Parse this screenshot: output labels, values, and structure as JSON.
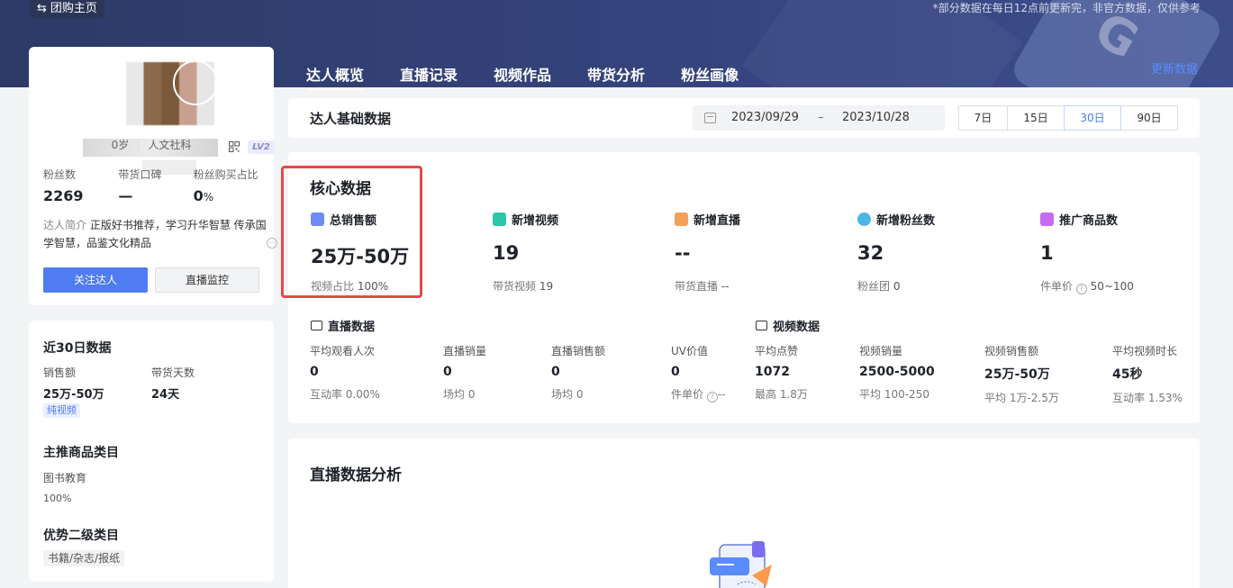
{
  "header": {
    "back_label": "团购主页",
    "notice": "*部分数据在每日12点前更新完，非官方数据，仅供参考",
    "update_link": "更新数据",
    "tabs": [
      {
        "label": "达人概览",
        "active": true
      },
      {
        "label": "直播记录",
        "active": false
      },
      {
        "label": "视频作品",
        "active": false
      },
      {
        "label": "带货分析",
        "active": false
      },
      {
        "label": "粉丝画像",
        "active": false
      }
    ]
  },
  "profile": {
    "level_badge": "LV2",
    "age": "0岁",
    "category": "人文社科",
    "stats": [
      {
        "label": "粉丝数",
        "value": "2269",
        "unit": ""
      },
      {
        "label": "带货口碑",
        "value": "—",
        "unit": ""
      },
      {
        "label": "粉丝购买占比",
        "value": "0",
        "unit": "%"
      }
    ],
    "intro_key": "达人简介",
    "intro_text": "正版好书推荐，学习升华智慧 传承国学智慧，品鉴文化精品",
    "follow_button": "关注达人",
    "monitor_button": "直播监控"
  },
  "recent": {
    "title": "近30日数据",
    "sales_label": "销售额",
    "sales_value": "25万-50万",
    "days_label": "带货天数",
    "days_value": "24天",
    "tag": "纯视频",
    "main_category_title": "主推商品类目",
    "main_category": "图书教育",
    "main_category_pct": "100%",
    "sub_category_title": "优势二级类目",
    "sub_category": "书籍/杂志/报纸"
  },
  "datebar": {
    "title": "达人基础数据",
    "start_date": "2023/09/29",
    "separator": "–",
    "end_date": "2023/10/28",
    "ranges": [
      {
        "label": "7日",
        "active": false
      },
      {
        "label": "15日",
        "active": false
      },
      {
        "label": "30日",
        "active": true
      },
      {
        "label": "90日",
        "active": false
      }
    ]
  },
  "core": {
    "title": "核心数据",
    "metrics": [
      {
        "label": "总销售额",
        "value": "25万-50万",
        "sub_label": "视频占比",
        "sub_value": "100%",
        "icon": "money-icon",
        "color": "#6b8cf5"
      },
      {
        "label": "新增视频",
        "value": "19",
        "sub_label": "带货视频",
        "sub_value": "19",
        "icon": "video-play-icon",
        "color": "#2cc6a8"
      },
      {
        "label": "新增直播",
        "value": "--",
        "sub_label": "带货直播",
        "sub_value": "--",
        "icon": "live-camera-icon",
        "color": "#f5a05a"
      },
      {
        "label": "新增粉丝数",
        "value": "32",
        "sub_label": "粉丝团",
        "sub_value": "0",
        "icon": "user-icon",
        "color": "#4cb6e8"
      },
      {
        "label": "推广商品数",
        "value": "1",
        "sub_label": "件单价",
        "sub_value": "50~100",
        "icon": "shopping-bag-icon",
        "color": "#c56cf0"
      }
    ]
  },
  "live_data": {
    "title": "直播数据",
    "metrics": [
      {
        "label": "平均观看人次",
        "value": "0",
        "sub": "互动率 0.00%"
      },
      {
        "label": "直播销量",
        "value": "0",
        "sub": "场均 0"
      },
      {
        "label": "直播销售额",
        "value": "0",
        "sub": "场均 0"
      },
      {
        "label": "UV价值",
        "value": "0",
        "sub_label": "件单价",
        "sub_value": "--"
      }
    ]
  },
  "video_data": {
    "title": "视频数据",
    "metrics": [
      {
        "label": "平均点赞",
        "value": "1072",
        "sub": "最高 1.8万"
      },
      {
        "label": "视频销量",
        "value": "2500-5000",
        "sub": "平均 100-250"
      },
      {
        "label": "视频销售额",
        "value": "25万-50万",
        "sub": "平均 1万-2.5万"
      },
      {
        "label": "平均视频时长",
        "value": "45秒",
        "sub": "互动率 1.53%"
      }
    ]
  },
  "analysis": {
    "title": "直播数据分析"
  }
}
